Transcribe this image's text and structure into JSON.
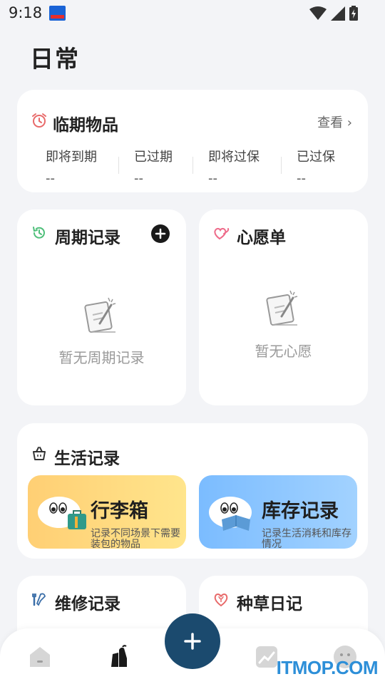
{
  "status_bar": {
    "time": "9:18",
    "app_icon": "notification-app-icon",
    "icons": [
      "wifi-icon",
      "signal-icon",
      "battery-charging-icon"
    ]
  },
  "page": {
    "title": "日常"
  },
  "expiring": {
    "title": "临期物品",
    "icon": "alarm-clock-icon",
    "view_label": "查看 ›",
    "stats": [
      {
        "label": "即将到期",
        "value": "--"
      },
      {
        "label": "已过期",
        "value": "--"
      },
      {
        "label": "即将过保",
        "value": "--"
      },
      {
        "label": "已过保",
        "value": "--"
      }
    ]
  },
  "periodic": {
    "title": "周期记录",
    "icon": "clock-history-icon",
    "add_icon": "add-circle-icon",
    "empty_text": "暂无周期记录"
  },
  "wishlist": {
    "title": "心愿单",
    "icon": "hearts-icon",
    "empty_text": "暂无心愿"
  },
  "life": {
    "title": "生活记录",
    "icon": "basket-icon",
    "tiles": [
      {
        "title": "行李箱",
        "desc": "记录不同场景下需要装包的物品",
        "color": "#ffd77a"
      },
      {
        "title": "库存记录",
        "desc": "记录生活消耗和库存情况",
        "color": "#8fc6ff"
      }
    ]
  },
  "repair": {
    "title": "维修记录",
    "icon": "tools-icon"
  },
  "grass": {
    "title": "种草日记",
    "icon": "heart-sprout-icon"
  },
  "nav": {
    "items": [
      "home-icon",
      "daily-icon",
      "add-icon",
      "stats-icon",
      "profile-icon"
    ],
    "fab_color": "#1b4a6e"
  },
  "watermark": "ITMOP.COM",
  "colors": {
    "background": "#f3f4f7",
    "card": "#ffffff",
    "accent_dark": "#1b4a6e"
  }
}
